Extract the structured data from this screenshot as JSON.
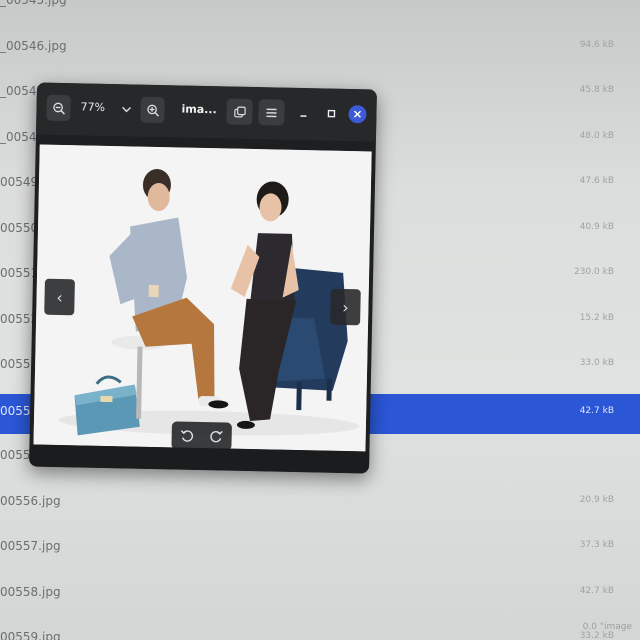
{
  "files": [
    {
      "name": "_00545.jpg",
      "size": ""
    },
    {
      "name": "_00546.jpg",
      "size": "94.6 kB"
    },
    {
      "name": "_00547.",
      "size": "45.8 kB"
    },
    {
      "name": "_00548.",
      "size": "48.0 kB"
    },
    {
      "name": "00549.",
      "size": "47.6 kB"
    },
    {
      "name": "00550.",
      "size": "40.9 kB"
    },
    {
      "name": "00551.",
      "size": "230.0 kB"
    },
    {
      "name": "00552.",
      "size": "15.2 kB"
    },
    {
      "name": "00553.",
      "size": "33.0 kB"
    },
    {
      "name": "00554.",
      "size": "42.7 kB"
    },
    {
      "name": "00555.",
      "size": ""
    },
    {
      "name": "00556.jpg",
      "size": "20.9 kB"
    },
    {
      "name": "00557.jpg",
      "size": "37.3 kB"
    },
    {
      "name": "00558.jpg",
      "size": "42.7 kB"
    },
    {
      "name": "00559.jpg",
      "size": "33.2 kB"
    }
  ],
  "selected_index": 9,
  "status_text": "0.0 \"image",
  "viewer": {
    "zoom_level": "77%",
    "title": "ima...",
    "icons": {
      "zoom_out": "zoom-out-icon",
      "zoom_in": "zoom-in-icon",
      "chevron": "chevron-down-icon",
      "copy": "copy-icon",
      "menu": "menu-icon",
      "minimize": "minimize-icon",
      "maximize": "maximize-icon",
      "close": "close-icon"
    },
    "prev_label": "‹",
    "next_label": "›"
  },
  "colors": {
    "selection": "#2b57d6",
    "close_button": "#3d5bd8"
  }
}
